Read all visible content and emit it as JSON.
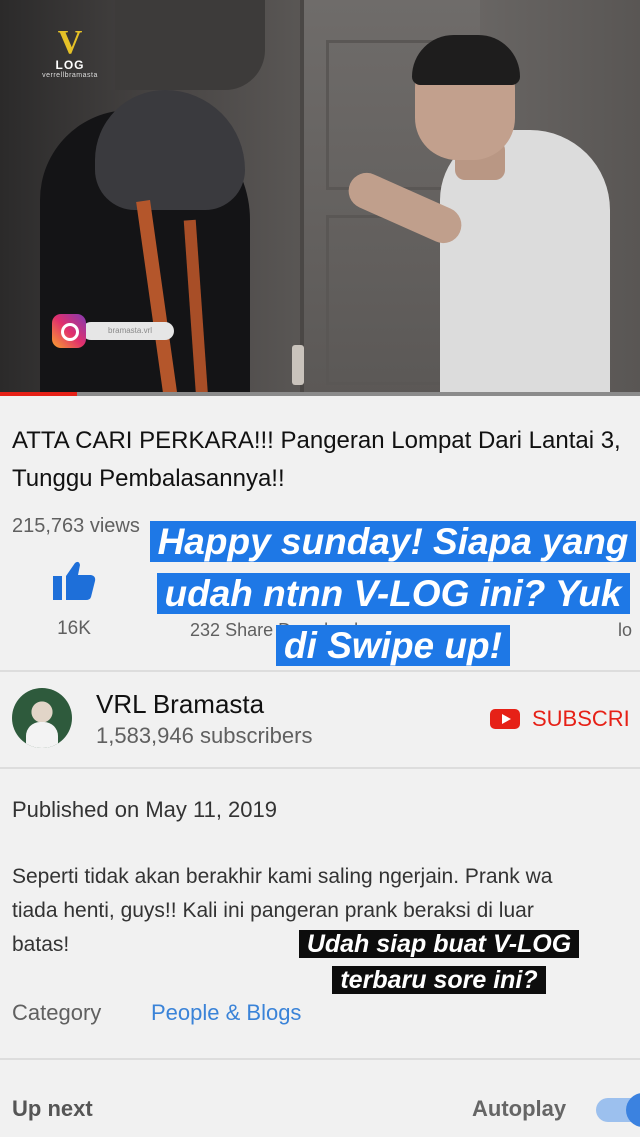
{
  "video": {
    "logo": {
      "mark": "V",
      "word": "LOG",
      "subtitle": "verrellbramasta"
    },
    "ig_handle": "bramasta.vrl",
    "progress_fraction": 0.12
  },
  "title": "ATTA CARI PERKARA!!! Pangeran Lompat Dari Lantai 3, Tunggu Pembalasannya!!",
  "views": "215,763 views",
  "actions": {
    "like_count": "16K",
    "partial_count": "232",
    "partial_labels": "Share    Download",
    "partial_right": "lo"
  },
  "channel": {
    "name": "VRL Bramasta",
    "subscribers": "1,583,946 subscribers",
    "subscribe_label": "SUBSCRI"
  },
  "description": {
    "published": "Published on May 11, 2019",
    "text": "Seperti tidak akan berakhir kami saling ngerjain. Prank wa\ntiada henti, guys!! Kali ini pangeran prank beraksi di luar\nbatas!",
    "category_label": "Category",
    "category_value": "People & Blogs"
  },
  "footer": {
    "up_next": "Up next",
    "autoplay": "Autoplay",
    "autoplay_on": true
  },
  "overlays": {
    "blue_text": "Happy sunday! Siapa yang udah ntnn V-LOG ini? Yuk di Swipe up!",
    "black_text": "Udah siap buat V-LOG terbaru sore ini?"
  },
  "colors": {
    "accent_red": "#e62117",
    "like_blue": "#1e6fd9",
    "link_blue": "#3a83d8",
    "overlay_blue": "#1e78e6"
  }
}
